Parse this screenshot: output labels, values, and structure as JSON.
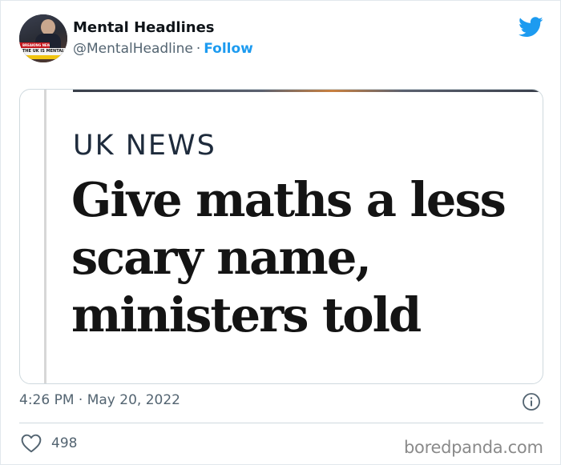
{
  "author": {
    "display_name": "Mental Headlines",
    "handle": "@MentalHeadline",
    "separator": "·",
    "follow_label": "Follow",
    "avatar": {
      "banner_top": "BREAKING NEWS",
      "banner_text": "THE UK IS MENTAL"
    }
  },
  "media": {
    "kicker": "UK NEWS",
    "headline": "Give maths a less scary name, ministers told"
  },
  "meta": {
    "timestamp": "4:26 PM · May 20, 2022",
    "like_count": "498"
  },
  "watermark": "boredpanda.com",
  "icons": {
    "brand": "twitter-bird-icon",
    "info": "info-icon",
    "like": "heart-icon"
  },
  "colors": {
    "twitter_blue": "#1d9bf0",
    "text_primary": "#0f1419",
    "text_secondary": "#536471",
    "border": "#cfd9de"
  }
}
